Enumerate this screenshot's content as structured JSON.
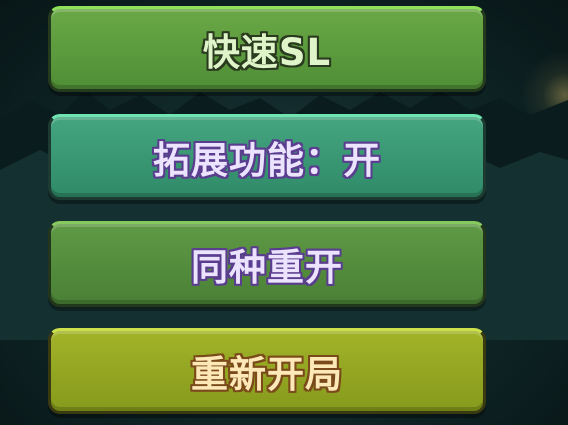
{
  "menu": {
    "buttons": [
      {
        "label": "快速SL"
      },
      {
        "label": "拓展功能：开"
      },
      {
        "label": "同种重开"
      },
      {
        "label": "重新开局"
      }
    ]
  },
  "colors": {
    "quick_sl_button": "#5a9a3e",
    "extend_button": "#3a9a75",
    "same_restart_button": "#558d3d",
    "restart_button": "#95a722",
    "background": "#122a2b"
  }
}
